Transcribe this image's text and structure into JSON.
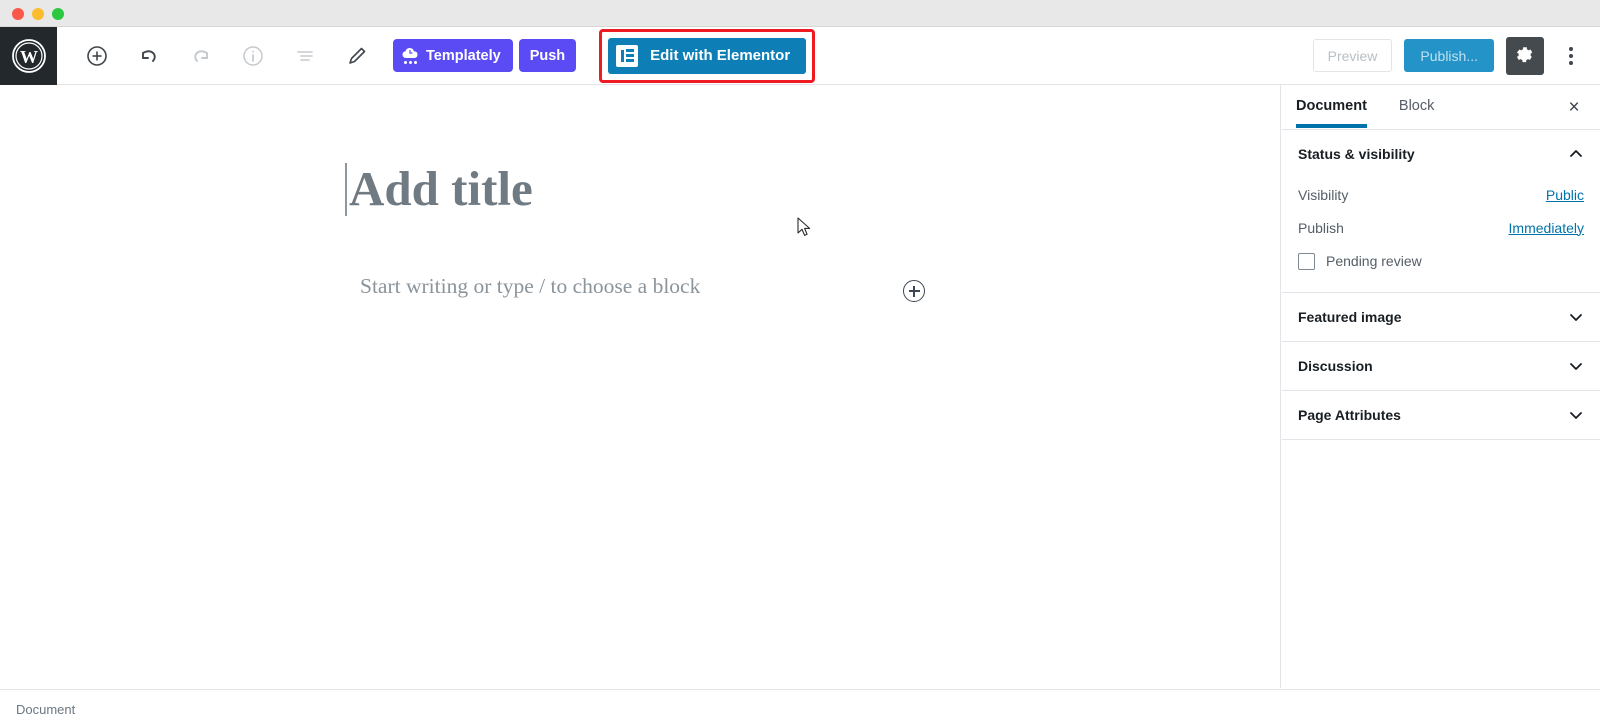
{
  "window": {
    "traffic_lights": [
      "close",
      "minimize",
      "maximize"
    ]
  },
  "topbar": {
    "logo": "wordpress-logo",
    "tools": [
      {
        "name": "add-block-icon",
        "label": "Add block",
        "enabled": true
      },
      {
        "name": "undo-icon",
        "label": "Undo",
        "enabled": true
      },
      {
        "name": "redo-icon",
        "label": "Redo",
        "enabled": false
      },
      {
        "name": "info-icon",
        "label": "Content structure",
        "enabled": false
      },
      {
        "name": "list-view-icon",
        "label": "Block navigation",
        "enabled": false
      },
      {
        "name": "edit-pencil-icon",
        "label": "Edit",
        "enabled": true
      }
    ],
    "templately_label": "Templately",
    "push_label": "Push",
    "elementor_label": "Edit with Elementor",
    "preview_label": "Preview",
    "publish_label": "Publish...",
    "settings_label": "Settings",
    "more_label": "More tools & options"
  },
  "canvas": {
    "title_placeholder": "Add title",
    "block_placeholder": "Start writing or type / to choose a block",
    "inserter_label": "Add block"
  },
  "sidebar": {
    "tabs": [
      {
        "label": "Document",
        "active": true
      },
      {
        "label": "Block",
        "active": false
      }
    ],
    "close_label": "×",
    "panels": [
      {
        "title": "Status & visibility",
        "expanded": true,
        "rows": [
          {
            "label": "Visibility",
            "value": "Public"
          },
          {
            "label": "Publish",
            "value": "Immediately"
          }
        ],
        "checkbox": {
          "label": "Pending review",
          "checked": false
        }
      },
      {
        "title": "Featured image",
        "expanded": false
      },
      {
        "title": "Discussion",
        "expanded": false
      },
      {
        "title": "Page Attributes",
        "expanded": false
      }
    ]
  },
  "statusbar": {
    "breadcrumb": "Document"
  },
  "colors": {
    "wp_admin_dark": "#23282d",
    "templately_purple": "#5b4bf5",
    "elementor_blue": "#0e7eb6",
    "publish_blue": "#2494c8",
    "link_blue": "#0073aa",
    "annotation_red": "#ee1b22"
  }
}
